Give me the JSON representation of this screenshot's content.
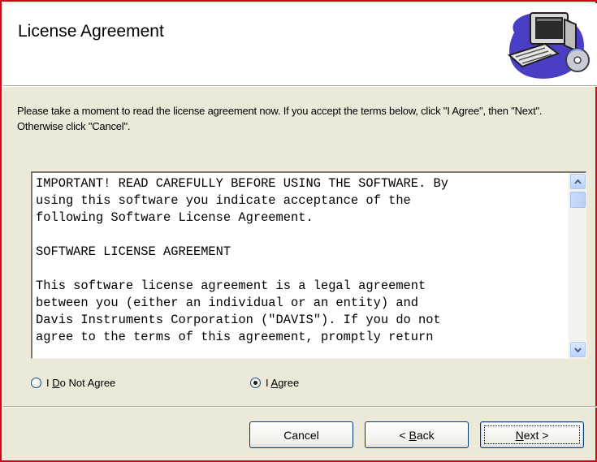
{
  "header": {
    "title": "License Agreement",
    "icon": "computer-cd-icon"
  },
  "instructions": "Please take a moment to read the license agreement now. If you accept the terms below, click \"I Agree\", then \"Next\". Otherwise click \"Cancel\".",
  "license": {
    "text": "IMPORTANT! READ CAREFULLY BEFORE USING THE SOFTWARE. By\nusing this software you indicate acceptance of the\nfollowing Software License Agreement.\n\nSOFTWARE LICENSE AGREEMENT\n\nThis software license agreement is a legal agreement\nbetween you (either an individual or an entity) and\nDavis Instruments Corporation (\"DAVIS\"). If you do not\nagree to the terms of this agreement, promptly return"
  },
  "options": {
    "disagree": {
      "prefix": "I ",
      "accel": "D",
      "rest": "o Not Agree",
      "checked": false
    },
    "agree": {
      "prefix": "I ",
      "accel": "A",
      "rest": "gree",
      "checked": true
    }
  },
  "buttons": {
    "cancel": "Cancel",
    "back": {
      "prefix": "< ",
      "accel": "B",
      "rest": "ack"
    },
    "next": {
      "prefix": "",
      "accel": "N",
      "rest": "ext >"
    }
  },
  "colors": {
    "window_border": "#d6001c",
    "dialog_bg": "#ece9d8",
    "button_border": "#003c74"
  }
}
